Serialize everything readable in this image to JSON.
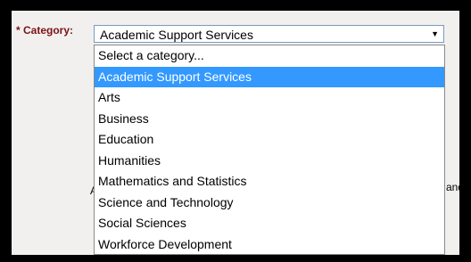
{
  "form": {
    "category_label": "* Category:",
    "selected_value": "Academic Support Services",
    "arrow_glyph": "▼",
    "options": [
      "Select a category...",
      "Academic Support Services",
      "Arts",
      "Business",
      "Education",
      "Humanities",
      "Mathematics and Statistics",
      "Science and Technology",
      "Social Sciences",
      "Workforce Development"
    ],
    "highlighted_index": 1,
    "partial_text_left": "A",
    "partial_text_right": "and"
  },
  "colors": {
    "label": "#7a1216",
    "highlight": "#3399ff",
    "background": "#f2f0ef"
  }
}
